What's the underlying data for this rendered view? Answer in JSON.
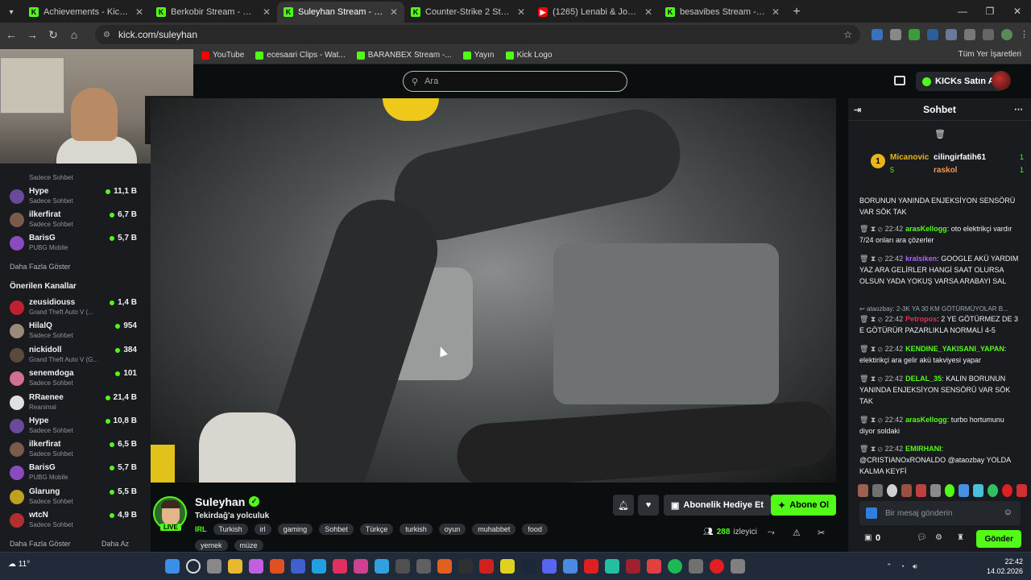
{
  "browser": {
    "tabs": [
      {
        "title": "Achievements - Kick Dashboard",
        "favicon": "kick-icon",
        "active": false
      },
      {
        "title": "Berkobir Stream - Watch Live o",
        "favicon": "kick-icon",
        "active": false
      },
      {
        "title": "Suleyhan Stream - Watch Li",
        "favicon": "kick-icon",
        "active": true
      },
      {
        "title": "Counter-Strike 2 Streaming - Li",
        "favicon": "kick-icon",
        "active": false
      },
      {
        "title": "(1265) Lenabi & Josef - Ankara",
        "favicon": "youtube-icon",
        "active": false
      },
      {
        "title": "besavibes Stream - Watch Live",
        "favicon": "kick-icon",
        "active": false
      }
    ],
    "url": "kick.com/suleyhan",
    "bookmarks": [
      "YouTube",
      "ecesaari Clips - Wat...",
      "BARANBEX Stream -...",
      "Yayın",
      "Kick Logo"
    ],
    "bookmarks_right": "Tüm Yer İşaretleri"
  },
  "header": {
    "search_placeholder": "Ara",
    "kicks_button": "KICKs Satın Al"
  },
  "sidebar": {
    "top_channels": [
      {
        "name": "",
        "sub": "Sadece Sohbet",
        "viewers": ""
      },
      {
        "name": "Hype",
        "sub": "Sadece Sohbet",
        "viewers": "11,1 B"
      },
      {
        "name": "ilkerfirat",
        "sub": "Sadece Sohbet",
        "viewers": "6,7 B"
      },
      {
        "name": "BarisG",
        "sub": "PUBG Mobile",
        "viewers": "5,7 B"
      }
    ],
    "show_more": "Daha Fazla Göster",
    "recommended_title": "Önerilen Kanallar",
    "recommended": [
      {
        "name": "zeusidiouss",
        "sub": "Grand Theft Auto V (...",
        "viewers": "1,4 B"
      },
      {
        "name": "HilalQ",
        "sub": "Sadece Sohbet",
        "viewers": "954"
      },
      {
        "name": "nickidoll",
        "sub": "Grand Theft Auto V (G...",
        "viewers": "384"
      },
      {
        "name": "senemdoga",
        "sub": "Sadece Sohbet",
        "viewers": "101"
      },
      {
        "name": "RRaenee",
        "sub": "Reanimal",
        "viewers": "21,4 B"
      },
      {
        "name": "Hype",
        "sub": "Sadece Sohbet",
        "viewers": "10,8 B"
      },
      {
        "name": "ilkerfirat",
        "sub": "Sadece Sohbet",
        "viewers": "6,5 B"
      },
      {
        "name": "BarisG",
        "sub": "PUBG Mobile",
        "viewers": "5,7 B"
      },
      {
        "name": "Glarung",
        "sub": "Sadece Sohbet",
        "viewers": "5,5 B"
      },
      {
        "name": "wtcN",
        "sub": "Sadece Sohbet",
        "viewers": "4,9 B"
      }
    ],
    "show_more_2": "Daha Fazla Göster",
    "show_less": "Daha Az"
  },
  "stream": {
    "name": "Suleyhan",
    "title": "Tekirdağ'a yolculuk",
    "live_badge": "LIVE",
    "category": "IRL",
    "tags": [
      "Turkish",
      "irl",
      "gaming",
      "Sohbet",
      "Türkçe",
      "turkish",
      "oyun",
      "muhabbet",
      "food",
      "yemek",
      "müze"
    ],
    "gift_button": "Abonelik Hediye Et",
    "subscribe_button": "Abone Ol",
    "viewers": "288",
    "viewers_label": "izleyici"
  },
  "chat": {
    "title": "Sohbet",
    "pinned": {
      "rank": "1",
      "user1": "Micanovic",
      "count1": "5",
      "user2": "cilingirfatih61",
      "count2": "1",
      "user3": "raskol",
      "count3": "1"
    },
    "messages": [
      {
        "time": "",
        "user": "",
        "color": "#ffffff",
        "text": "BORUNUN YANINDA ENJEKSİYON SENSÖRÜ VAR SÖK TAK"
      },
      {
        "time": "22:42",
        "user": "arasKellogg",
        "color": "#53fc18",
        "text": "oto elektrikçi vardır 7/24 onları ara çözerler"
      },
      {
        "time": "22:42",
        "user": "kralsiken",
        "color": "#b060ff",
        "text": "GOOGLE AKÜ YARDIM YAZ ARA GELİRLER HANGİ SAAT OLURSA OLSUN YADA YOKUŞ VARSA ARABAYI SAL"
      },
      {
        "time": "",
        "user": "",
        "color": "#9aa0a6",
        "text": "ataozbay: 2-3K YA 30 KM GÖTÜRMÜYOLAR B..."
      },
      {
        "time": "22:42",
        "user": "Petropos",
        "color": "#e03050",
        "text": "2 YE GÖTÜRMEZ DE 3 E GÖTÜRÜR PAZARLIKLA NORMALİ 4-5"
      },
      {
        "time": "22:42",
        "user": "KENDINE_YAKISANI_YAPAN",
        "color": "#53fc18",
        "text": "elektirikçi ara gelir akü takviyesi yapar"
      },
      {
        "time": "22:42",
        "user": "DELAL_35",
        "color": "#53fc18",
        "text": "KALIN BORUNUN YANINDA ENJEKSİYON SENSÖRÜ VAR SÖK TAK"
      },
      {
        "time": "22:42",
        "user": "arasKellogg",
        "color": "#53fc18",
        "text": "turbo hortumunu diyor soldaki"
      },
      {
        "time": "22:42",
        "user": "EMIRHANI",
        "color": "#53fc18",
        "text": "@CRISTIANOxRONALDO @ataozbay YOLDA KALMA KEYFİ"
      }
    ],
    "input_placeholder": "Bir mesaj gönderin",
    "points": "0",
    "send_button": "Gönder"
  },
  "taskbar": {
    "weather": "11°",
    "time": "22:42",
    "date": "14.02.2026"
  },
  "colors": {
    "accent": "#53fc18",
    "background": "#0b0e0f",
    "panel": "#191b1f"
  }
}
